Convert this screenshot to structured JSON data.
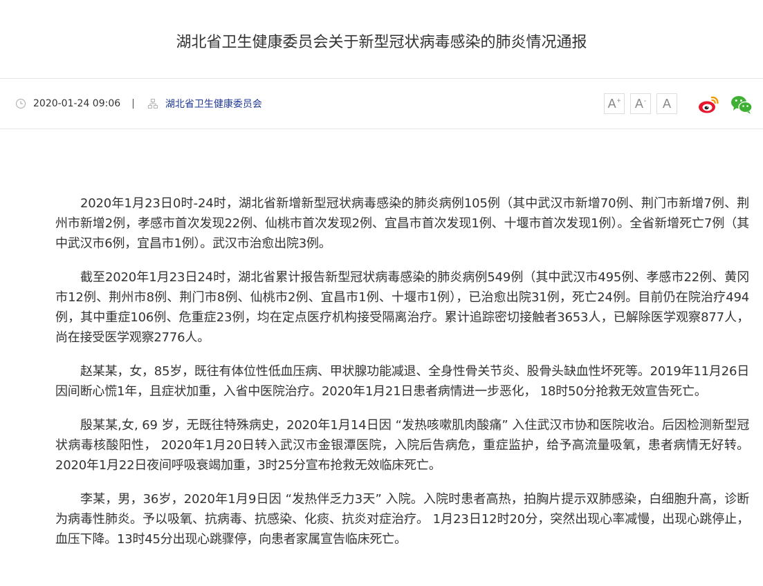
{
  "article": {
    "title": "湖北省卫生健康委员会关于新型冠状病毒感染的肺炎情况通报",
    "date": "2020-01-24 09:06",
    "separator": "|",
    "source": "湖北省卫生健康委员会"
  },
  "font_controls": {
    "increase_label": "A",
    "increase_sup": "+",
    "decrease_label": "A",
    "decrease_sup": "-",
    "reset_label": "A"
  },
  "share": {
    "weibo_icon": "weibo-icon",
    "wechat_icon": "wechat-icon",
    "weibo_color": "#e6162d",
    "wechat_color": "#3eb135"
  },
  "paragraphs": [
    "2020年1月23日0时-24时，湖北省新增新型冠状病毒感染的肺炎病例105例（其中武汉市新增70例、荆门市新增7例、荆州市新增2例，孝感市首次发现22例、仙桃市首次发现2例、宜昌市首次发现1例、十堰市首次发现1例）。全省新增死亡7例（其中武汉市6例，宜昌市1例）。武汉市治愈出院3例。",
    "截至2020年1月23日24时，湖北省累计报告新型冠状病毒感染的肺炎病例549例（其中武汉市495例、孝感市22例、黄冈市12例、荆州市8例、荆门市8例、仙桃市2例、宜昌市1例、十堰市1例），已治愈出院31例，死亡24例。目前仍在院治疗494例，其中重症106例、危重症23例，均在定点医疗机构接受隔离治疗。累计追踪密切接触者3653人，已解除医学观察877人，尚在接受医学观察2776人。",
    "赵某某，女，85岁，既往有体位性低血压病、甲状腺功能减退、全身性骨关节炎、股骨头缺血性坏死等。2019年11月26日因间断心慌1年，且症状加重，入省中医院治疗。2020年1月21日患者病情进一步恶化， 18时50分抢救无效宣告死亡。",
    "殷某某,女, 69 岁，无既往特殊病史，2020年1月14日因 “发热咳嗽肌肉酸痛” 入住武汉市协和医院收治。后因检测新型冠状病毒核酸阳性， 2020年1月20日转入武汉市金银潭医院，入院后告病危，重症监护，给予高流量吸氧，患者病情无好转。2020年1月22日夜间呼吸衰竭加重，3时25分宣布抢救无效临床死亡。",
    "李某，男，36岁，2020年1月9日因 “发热伴乏力3天” 入院。入院时患者高热，拍胸片提示双肺感染，白细胞升高，诊断为病毒性肺炎。予以吸氧、抗病毒、抗感染、化痰、抗炎对症治疗。 1月23日12时20分，突然出现心率减慢，出现心跳停止，血压下降。13时45分出现心跳骤停，向患者家属宣告临床死亡。"
  ]
}
